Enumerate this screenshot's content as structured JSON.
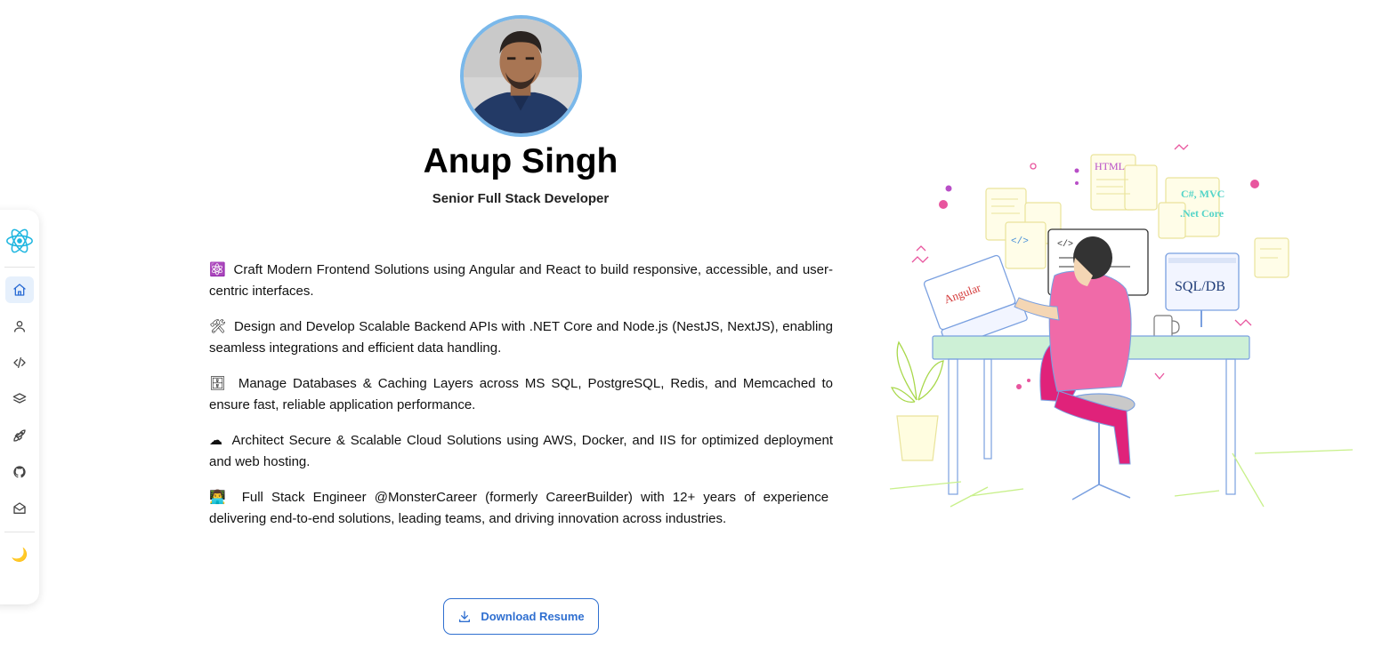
{
  "profile": {
    "name": "Anup Singh",
    "role": "Senior Full Stack Developer"
  },
  "bullets": [
    {
      "icon": "⚛️",
      "text": "Craft Modern Frontend Solutions using Angular and React to build responsive, accessible, and user-centric interfaces."
    },
    {
      "icon": "🛠",
      "text": "Design and Develop Scalable Backend APIs with .NET Core and Node.js (NestJS, NextJS), enabling seamless integrations and efficient data handling."
    },
    {
      "icon": "🗄",
      "text": "Manage Databases & Caching Layers across MS SQL, PostgreSQL, Redis, and Memcached to ensure fast, reliable application performance."
    },
    {
      "icon": "☁",
      "text": "Architect Secure & Scalable Cloud Solutions using AWS, Docker, and IIS for optimized deployment and web hosting."
    },
    {
      "icon": "👨‍💻",
      "text": "Full Stack Engineer @MonsterCareer (formerly CareerBuilder) with 12+ years of experience delivering end-to-end solutions, leading teams, and driving innovation across industries."
    }
  ],
  "actions": {
    "download_label": "Download Resume"
  },
  "sidebar": {
    "items": [
      "home-icon",
      "user-icon",
      "code-icon",
      "layers-icon",
      "rocket-icon",
      "github-icon",
      "mail-icon"
    ],
    "theme_toggle": "🌙"
  },
  "illustration": {
    "labels": {
      "html": "HTML",
      "csharp": "C#, MVC",
      "netcore": ".Net Core",
      "sql": "SQL/DB",
      "angular": "Angular",
      "tag": "</>"
    }
  },
  "colors": {
    "accent": "#2f6fd0",
    "avatar_ring": "#7ab8ea",
    "react_logo": "#1fb6e0",
    "person_shirt": "#f06aa8"
  }
}
